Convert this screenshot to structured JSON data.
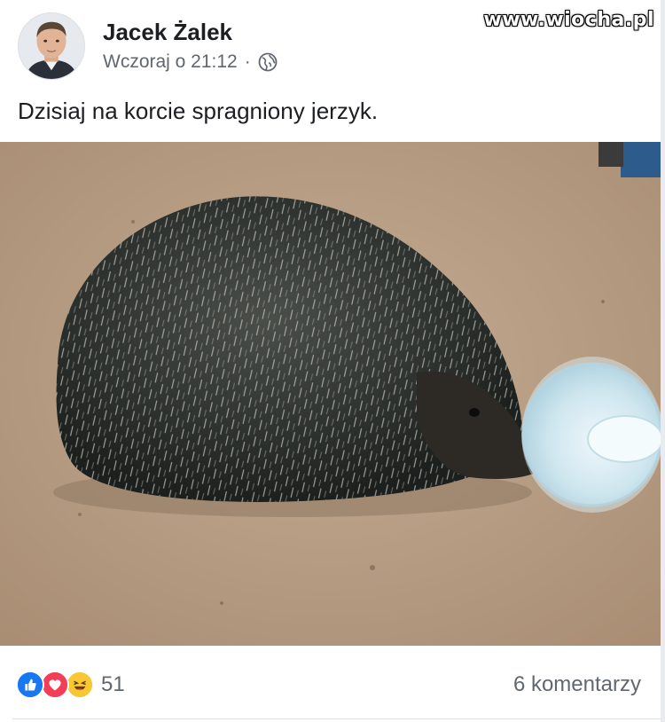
{
  "post": {
    "author": "Jacek Żalek",
    "timestamp": "Wczoraj o 21:12",
    "separator": "·",
    "privacy_icon": "globe-icon",
    "text": "Dzisiaj na korcie spragniony jerzyk.",
    "photo_subject": "hedgehog-drinking-from-bowl"
  },
  "watermark": "www.wiocha.pl",
  "footer": {
    "reaction_icons": [
      "like-icon",
      "love-icon",
      "haha-icon"
    ],
    "reaction_count": "51",
    "comments": "6 komentarzy"
  },
  "colors": {
    "like": "#1877f2",
    "love": "#f33e58",
    "haha": "#f7b125",
    "muted_text": "#606770",
    "ground": "#b89f86"
  }
}
